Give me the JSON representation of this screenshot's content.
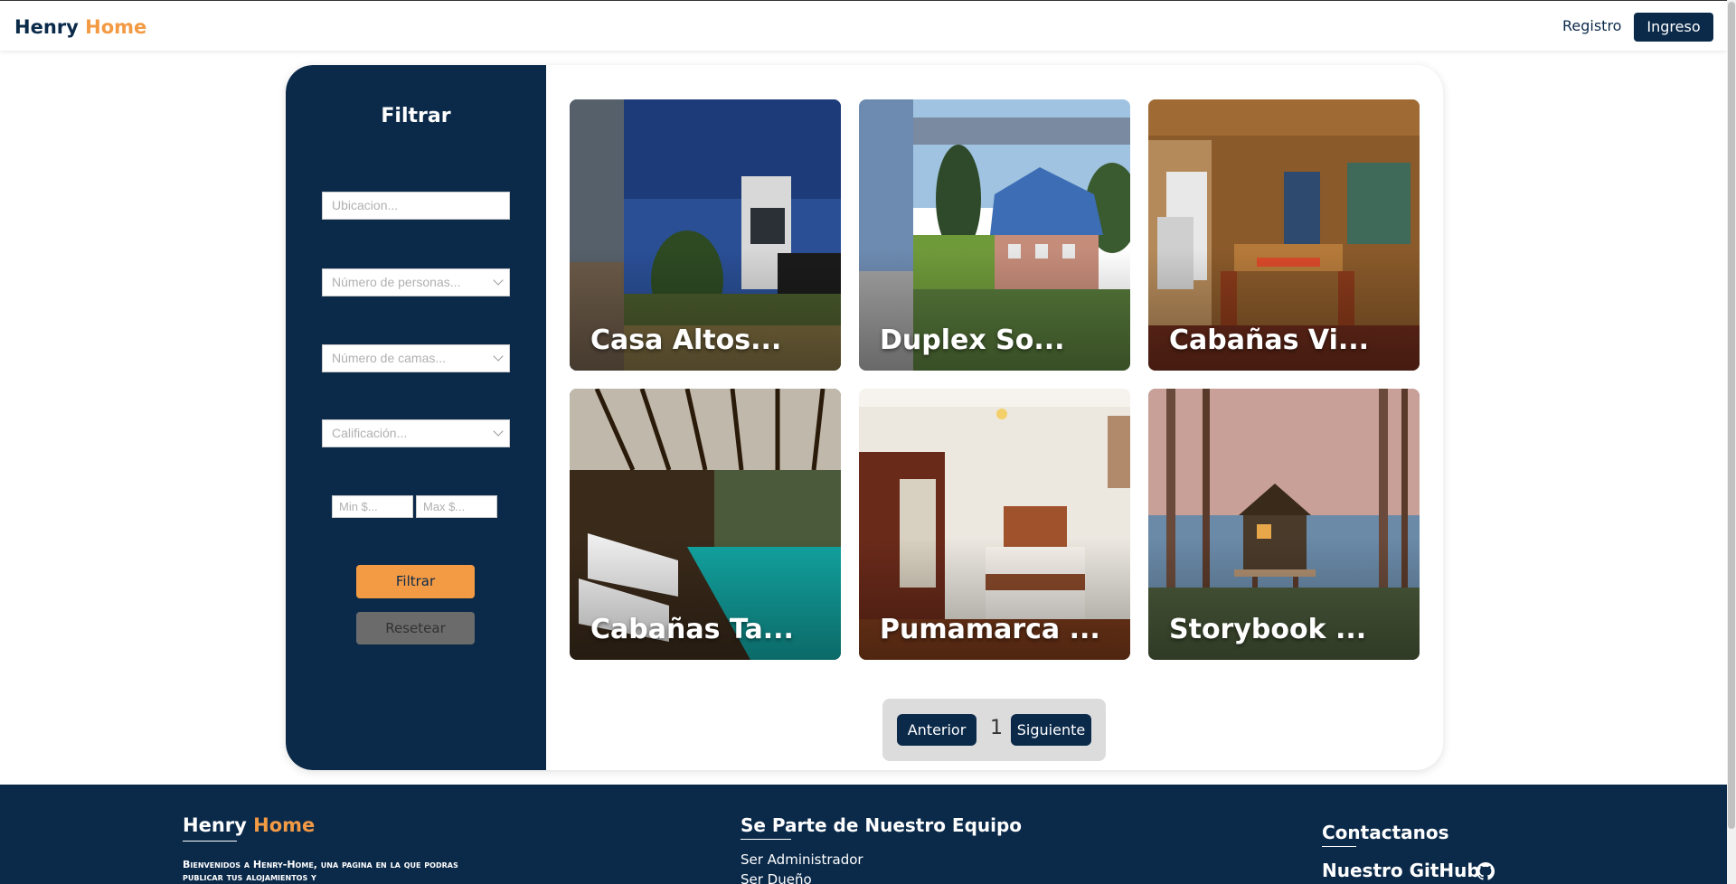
{
  "navbar": {
    "brand_first": "Henry",
    "brand_second": "Home",
    "registro": "Registro",
    "ingreso": "Ingreso"
  },
  "filter": {
    "title": "Filtrar",
    "ubicacion_placeholder": "Ubicacion...",
    "personas_placeholder": "Número de personas...",
    "camas_placeholder": "Número de camas...",
    "calificacion_placeholder": "Calificación...",
    "min_placeholder": "Min $...",
    "max_placeholder": "Max $...",
    "filtrar_label": "Filtrar",
    "resetear_label": "Resetear"
  },
  "properties": [
    {
      "name": "Casa Altos..."
    },
    {
      "name": "Duplex So..."
    },
    {
      "name": "Cabañas Vi..."
    },
    {
      "name": "Cabañas Ta..."
    },
    {
      "name": "Pumamarca ..."
    },
    {
      "name": "Storybook ..."
    }
  ],
  "pagination": {
    "prev": "Anterior",
    "page": "1",
    "next": "Siguiente"
  },
  "footer": {
    "brand_first": "Henry",
    "brand_second": "Home",
    "description": "Bienvenidos a Henry-Home, una pagina en la que podras publicar tus alojamientos y",
    "team_heading": "Se Parte de Nuestro Equipo",
    "link_admin": "Ser Administrador",
    "link_owner": "Ser Dueño",
    "contact_heading": "Contactanos",
    "github_label": "Nuestro GitHub"
  },
  "colors": {
    "navy": "#0b2a4a",
    "orange": "#f39a44",
    "reset_gray": "#6b6b6b"
  },
  "icons": [
    "chevron-down-icon",
    "github-icon"
  ]
}
